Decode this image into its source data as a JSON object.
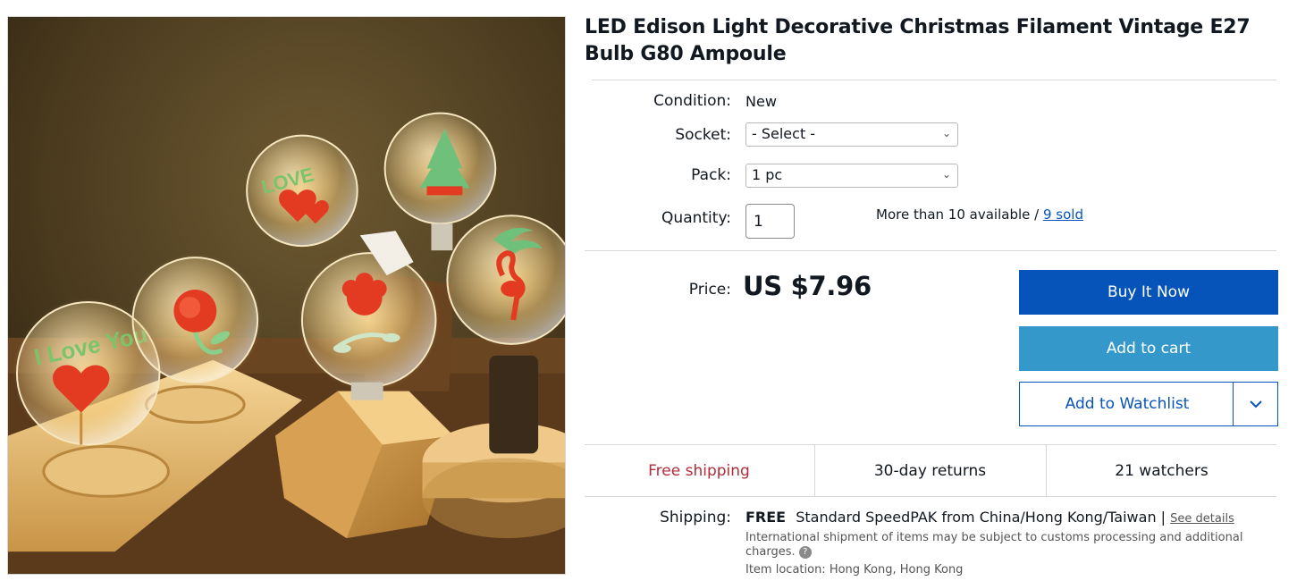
{
  "product": {
    "title": "LED Edison Light Decorative Christmas Filament Vintage E27 Bulb G80 Ampoule",
    "image_alt": "Vintage filament bulbs with heart, rose, Christmas tree, love and flamingo shapes on wooden bases"
  },
  "details": {
    "condition_label": "Condition:",
    "condition_value": "New",
    "socket_label": "Socket:",
    "socket_value": "- Select -",
    "pack_label": "Pack:",
    "pack_value": "1 pc",
    "quantity_label": "Quantity:",
    "quantity_value": "1",
    "availability": "More than 10 available /",
    "sold": "9 sold"
  },
  "pricing": {
    "price_label": "Price:",
    "price": "US $7.96"
  },
  "actions": {
    "buy_now": "Buy It Now",
    "add_to_cart": "Add to cart",
    "add_to_watchlist": "Add to Watchlist"
  },
  "highlights": {
    "shipping": "Free shipping",
    "returns": "30-day returns",
    "watchers": "21 watchers"
  },
  "shipping": {
    "label": "Shipping:",
    "free": "FREE",
    "method": "Standard SpeedPAK from China/Hong Kong/Taiwan |",
    "see_details": "See details",
    "note": "International shipment of items may be subject to customs processing and additional charges.",
    "item_location": "Item location:  Hong Kong, Hong Kong"
  },
  "colors": {
    "buy_button": "#0654ba",
    "cart_button": "#3498ca",
    "free_shipping": "#b12d3a",
    "link": "#0654ba"
  },
  "icons": {
    "select_chevron": "chevron-down-icon",
    "watchlist_dropdown": "chevron-down-icon",
    "help": "question-circle-icon"
  }
}
